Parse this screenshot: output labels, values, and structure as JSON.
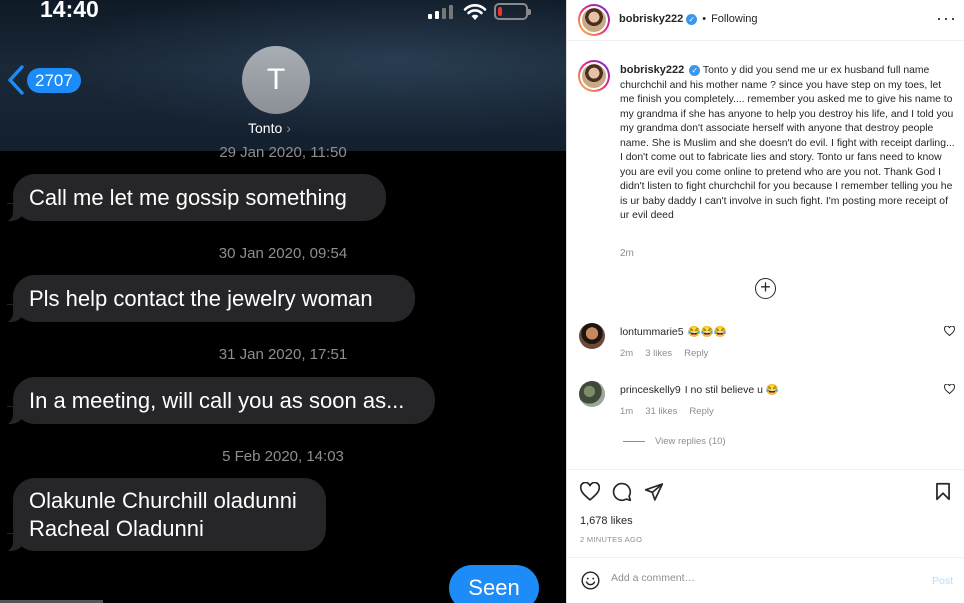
{
  "phone": {
    "time": "14:40",
    "back_count": "2707",
    "contact_initial": "T",
    "contact_name": "Tonto",
    "battery_level": 0.15,
    "battery_color": "#e8372e",
    "accent": "#1d8cf8",
    "messages": [
      {
        "timestamp": "29 Jan 2020, 11:50",
        "text": "Call me let me gossip something"
      },
      {
        "timestamp": "30 Jan 2020, 09:54",
        "text": "Pls help contact the jewelry woman"
      },
      {
        "timestamp": "31 Jan 2020, 17:51",
        "text": "In a meeting, will call you as soon as..."
      },
      {
        "timestamp": "5 Feb 2020, 14:03",
        "text_lines": [
          "Olakunle Churchill oladunni",
          "Racheal Oladunni"
        ]
      }
    ],
    "seen_label": "Seen"
  },
  "ig": {
    "header": {
      "username": "bobrisky222",
      "follow_status": "Following"
    },
    "caption": {
      "username": "bobrisky222",
      "text": "Tonto y did you send me ur ex husband full name churchchil and his mother name ? since you have step on my toes, let me finish you completely.... remember you asked me to give his name to my grandma if she has anyone to help you destroy his life, and I told you my grandma don't associate herself with anyone that destroy people name. She is Muslim and she doesn't do evil. I fight with receipt darling... I don't come out to fabricate lies and story. Tonto ur fans need to know you are evil you come online to pretend who are you not. Thank God I didn't listen to fight churchchil for you because I remember telling you he is ur baby daddy I can't involve in such fight. I'm posting more receipt of ur evil deed",
      "time": "2m"
    },
    "comments": [
      {
        "username": "lontummarie5",
        "text": "😂😂😂",
        "time": "2m",
        "likes": "3 likes",
        "reply": "Reply"
      },
      {
        "username": "princeskelly9",
        "text": "I no stil believe u 😂",
        "time": "1m",
        "likes": "31 likes",
        "reply": "Reply"
      }
    ],
    "view_replies": "View replies (10)",
    "likes": "1,678 likes",
    "posted": "2 MINUTES AGO",
    "comment_placeholder": "Add a comment…",
    "post_label": "Post",
    "icons": [
      "more-icon",
      "add-circle-icon",
      "heart-icon",
      "comment-icon",
      "share-icon",
      "bookmark-icon",
      "emoji-icon"
    ]
  }
}
